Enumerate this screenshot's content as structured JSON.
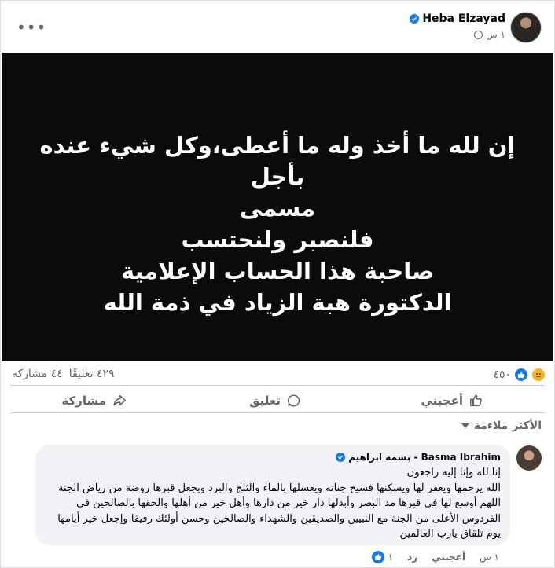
{
  "post": {
    "author": "Heba Elzayad",
    "time": "١ س",
    "image_text": "إن لله ما أخذ وله ما أعطى،وكل شيء عنده بأجل\nمسمى\nفلنصبر ولنحتسب\nصاحبة هذا الحساب الإعلامية\nالدكتورة هبة الزياد في ذمة الله"
  },
  "stats": {
    "reactions": "٤٥٠",
    "comments": "٤٢٩ تعليقًا",
    "shares": "٤٤ مشاركة"
  },
  "actions": {
    "like": "أعجبني",
    "comment": "تعليق",
    "share": "مشاركة"
  },
  "sort": {
    "label": "الأكثر ملاءمة"
  },
  "comment": {
    "author": "بسمه ابراهيم - Basma Ibrahim",
    "text": "إنا لله وإنا إليه راجعون\nالله يرحمها ويغفر لها ويسكنها فسيح جناته ويغسلها بالماء والثلج والبرد ويجعل قبرها روضة من رياض الجنة اللهم أوسع لها فى قبرها مد البصر وأبدلها دار خير من دارها وأهل خير من أهلها والحقها بالصالحين في الفردوس الأعلى من الجنة مع النبيين والصديقين والشهداء والصالحين وحسن أولئك رفيقا وإجعل خير أيامها يوم تلقاق يارب العالمين",
    "time": "١ س",
    "like": "أعجبني",
    "reply": "رد",
    "likes": "١"
  },
  "colors": {
    "accent": "#1877f2",
    "muted": "#65676b",
    "image_bg": "#0b0b0b"
  }
}
